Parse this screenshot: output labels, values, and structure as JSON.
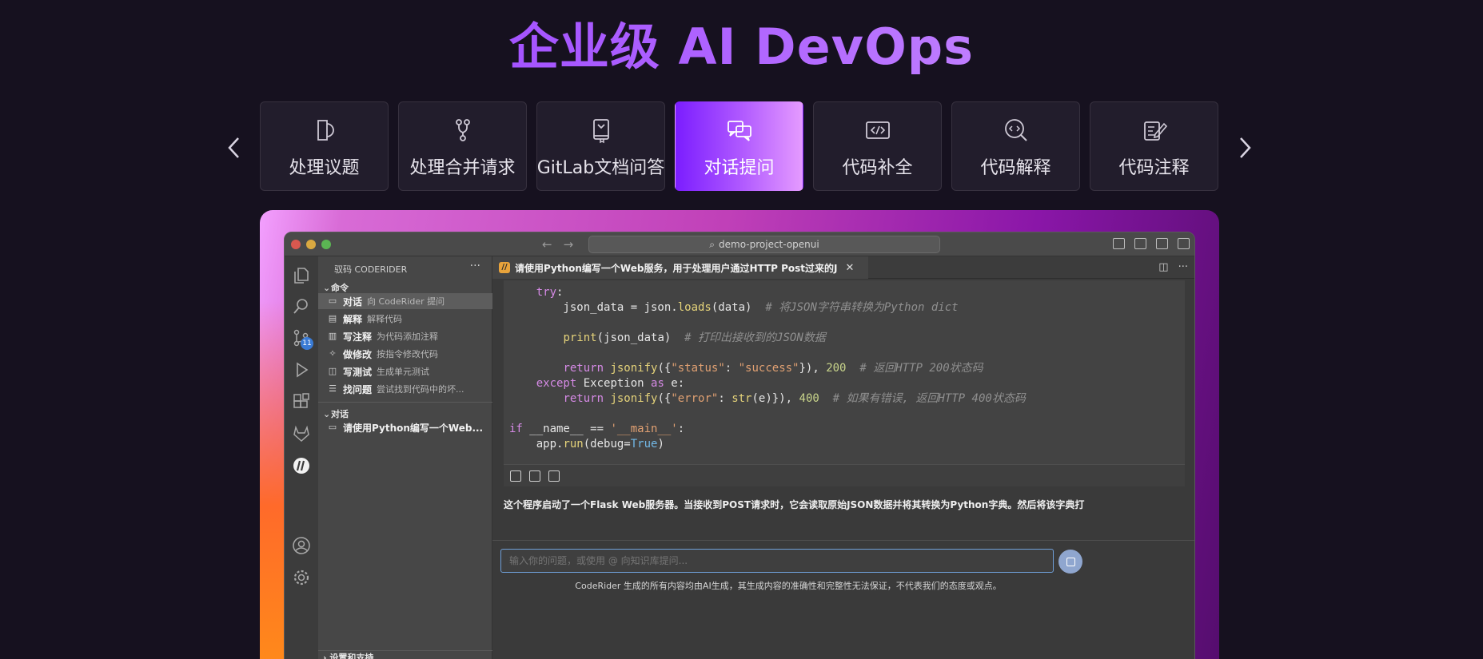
{
  "hero": {
    "title": "企业级 AI DevOps"
  },
  "carousel": {
    "prev_icon": "chevron-left-icon",
    "next_icon": "chevron-right-icon",
    "tabs": [
      {
        "label": "处理议题",
        "icon": "issue-icon",
        "active": false
      },
      {
        "label": "处理合并请求",
        "icon": "merge-request-icon",
        "active": false
      },
      {
        "label": "GitLab文档问答",
        "icon": "docs-icon",
        "active": false
      },
      {
        "label": "对话提问",
        "icon": "chat-icon",
        "active": true
      },
      {
        "label": "代码补全",
        "icon": "code-icon",
        "active": false
      },
      {
        "label": "代码解释",
        "icon": "code-search-icon",
        "active": false
      },
      {
        "label": "代码注释",
        "icon": "code-comment-icon",
        "active": false
      }
    ]
  },
  "ide": {
    "search_text": "demo-project-openui",
    "source_control_badge": "11",
    "sidebar": {
      "header": "驭码 CODERIDER",
      "commands_title": "命令",
      "commands": [
        {
          "name": "对话",
          "desc": "向 CodeRider 提问",
          "icon": "chat-icon"
        },
        {
          "name": "解释",
          "desc": "解释代码",
          "icon": "doc-icon"
        },
        {
          "name": "写注释",
          "desc": "为代码添加注释",
          "icon": "comment-icon"
        },
        {
          "name": "做修改",
          "desc": "按指令修改代码",
          "icon": "wand-icon"
        },
        {
          "name": "写测试",
          "desc": "生成单元测试",
          "icon": "cube-icon"
        },
        {
          "name": "找问题",
          "desc": "尝试找到代码中的坏...",
          "icon": "list-icon"
        }
      ],
      "conversations_title": "对话",
      "conversations": [
        {
          "label": "请使用Python编写一个Web..."
        }
      ],
      "footer": "设置和支持"
    },
    "editor_tab": "请使用Python编写一个Web服务，用于处理用户通过HTTP Post过来的J",
    "answer": "这个程序启动了一个Flask Web服务器。当接收到POST请求时，它会读取原始JSON数据并将其转换为Python字典。然后将该字典打",
    "input_placeholder": "输入你的问题，或使用 @ 向知识库提问...",
    "disclaimer": "CodeRider 生成的所有内容均由AI生成，其生成内容的准确性和完整性无法保证，不代表我们的态度或观点。"
  },
  "colors": {
    "accent_start": "#7b1dff",
    "accent_end": "#e59bff",
    "background": "#16111f"
  }
}
